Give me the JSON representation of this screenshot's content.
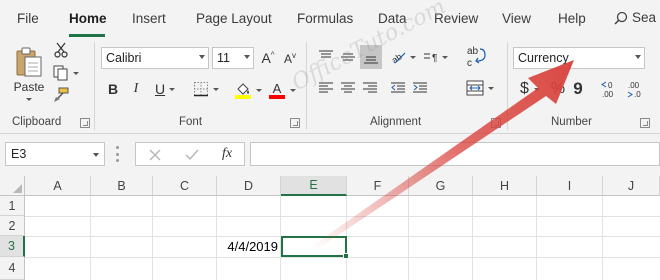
{
  "tabs": [
    {
      "label": "File"
    },
    {
      "label": "Home"
    },
    {
      "label": "Insert"
    },
    {
      "label": "Page Layout"
    },
    {
      "label": "Formulas"
    },
    {
      "label": "Data"
    },
    {
      "label": "Review"
    },
    {
      "label": "View"
    },
    {
      "label": "Help"
    }
  ],
  "search_label": "Sea",
  "ribbon": {
    "clipboard": {
      "label": "Clipboard",
      "paste_label": "Paste"
    },
    "font": {
      "label": "Font",
      "family": "Calibri",
      "size": "11"
    },
    "alignment": {
      "label": "Alignment"
    },
    "number": {
      "label": "Number",
      "format": "Currency",
      "percent": "%",
      "comma": "9",
      "dollar": "$"
    }
  },
  "formula_bar": {
    "name_box": "E3",
    "fx": "fx",
    "value": ""
  },
  "grid": {
    "columns": [
      "A",
      "B",
      "C",
      "D",
      "E",
      "F",
      "G",
      "H",
      "I",
      "J"
    ],
    "rows": [
      "1",
      "2",
      "3",
      "4"
    ],
    "d3_value": "4/4/2019"
  },
  "watermark": "OfficeTuto.com",
  "colors": {
    "accent": "#217346",
    "font_color": "#ff0000",
    "highlight": "#ffff00",
    "arrow": "#d9403a"
  }
}
